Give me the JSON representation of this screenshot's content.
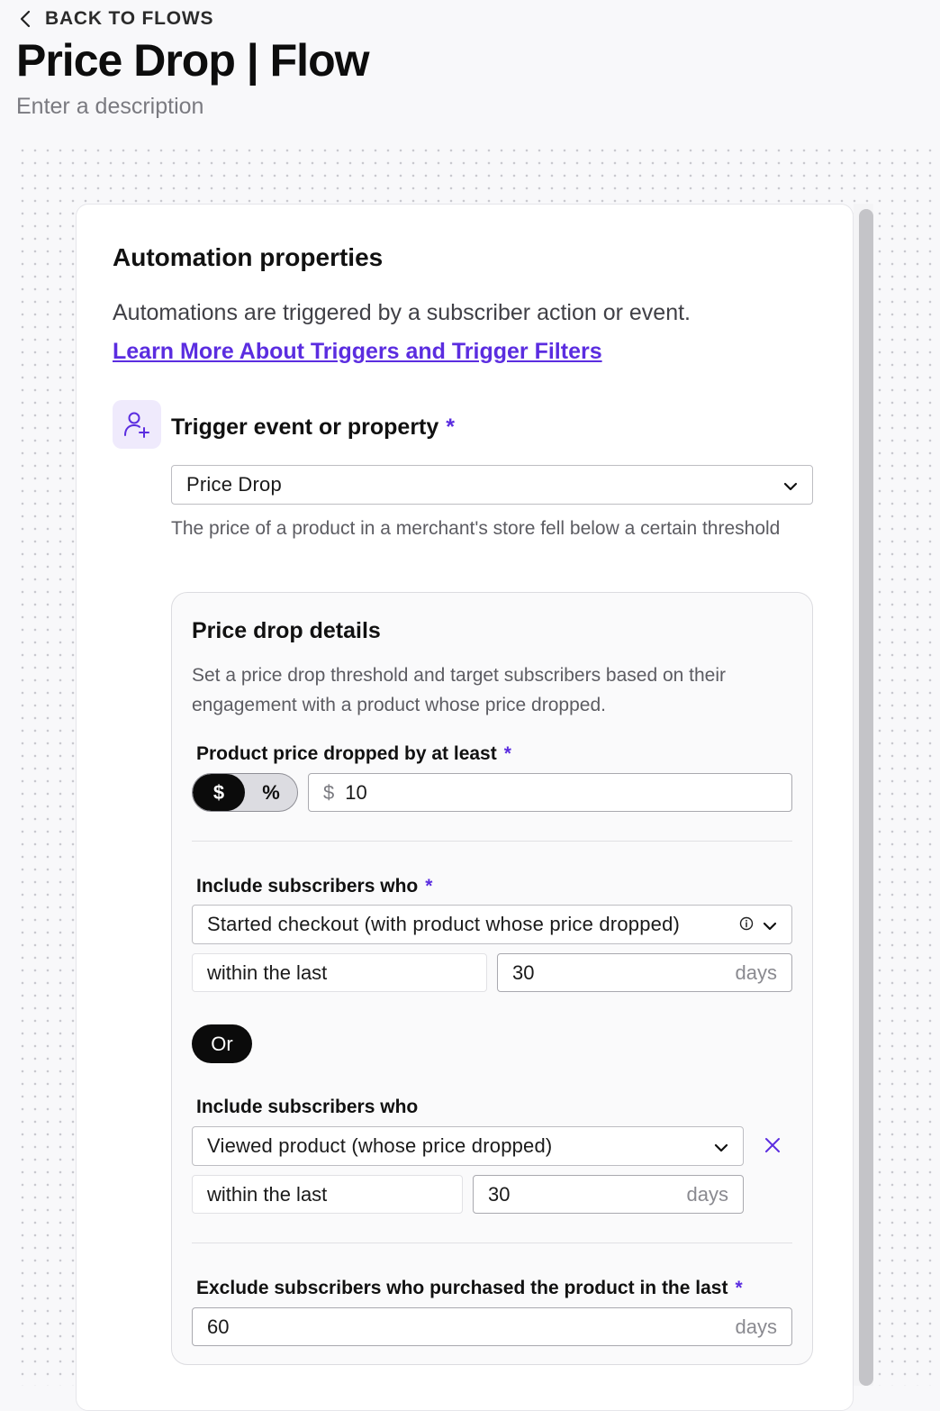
{
  "header": {
    "back_label": "BACK TO FLOWS",
    "title": "Price Drop | Flow",
    "description_placeholder": "Enter a description"
  },
  "automation": {
    "title": "Automation properties",
    "description": "Automations are triggered by a subscriber action or event.",
    "learn_more": "Learn More About Triggers and Trigger Filters",
    "trigger_label": "Trigger event or property",
    "required_mark": "*",
    "trigger_value": "Price Drop",
    "trigger_help": "The price of a product in a merchant's store fell below a certain threshold"
  },
  "details": {
    "title": "Price drop details",
    "description": "Set a price drop threshold and target subscribers based on their engagement with a product whose price dropped.",
    "threshold_label": "Product price dropped by at least",
    "toggle_options": [
      "$",
      "%"
    ],
    "toggle_selected": "$",
    "threshold_prefix": "$",
    "threshold_value": "10",
    "include_1": {
      "label": "Include subscribers who",
      "action": "Started checkout (with product whose price dropped)",
      "within": "within the last",
      "days_value": "30",
      "days_unit": "days"
    },
    "or_label": "Or",
    "include_2": {
      "label": "Include subscribers who",
      "action": "Viewed product (whose price dropped)",
      "within": "within the last",
      "days_value": "30",
      "days_unit": "days"
    },
    "exclude": {
      "label": "Exclude subscribers who purchased the product in the last",
      "days_value": "60",
      "days_unit": "days"
    }
  },
  "colors": {
    "accent": "#5b2de0",
    "background": "#f8f8fa",
    "panel": "#ffffff",
    "toggle_active": "#0b0b0b"
  },
  "icons": {
    "back": "chevron-left-icon",
    "trigger": "user-add-icon",
    "dropdown": "chevron-down-icon",
    "info": "info-icon",
    "remove": "close-icon"
  }
}
